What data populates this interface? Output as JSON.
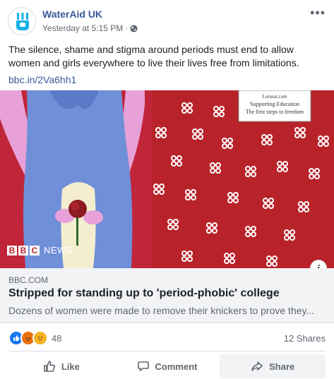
{
  "post": {
    "page_name": "WaterAid UK",
    "timestamp": "Yesterday at 5:15 PM",
    "separator": "·",
    "privacy_icon": "globe-icon",
    "more_label": "•••",
    "text": "The silence, shame and stigma around periods must end to allow women and girls everywhere to live their lives free from limitations.",
    "link_text": "bbc.in/2Va6hh1"
  },
  "link_preview": {
    "image_description_icon": "illustration",
    "sign_lines": [
      "Lorusat.com",
      "Supporting Education",
      "The first steps to freedom"
    ],
    "brand_letters": [
      "B",
      "B",
      "C"
    ],
    "brand_word": "NEWS",
    "info_label": "i",
    "domain": "BBC.COM",
    "headline": "Stripped for standing up to 'period-phobic' college",
    "description": "Dozens of women were made to remove their knickers to prove they..."
  },
  "engagement": {
    "reactions": [
      "like-icon",
      "angry-icon",
      "sad-icon"
    ],
    "reaction_count": "48",
    "shares": "12 Shares"
  },
  "actions": {
    "like": "Like",
    "comment": "Comment",
    "share": "Share"
  },
  "colors": {
    "accent": "#385898",
    "background_red": "#b8232a",
    "figure_blue": "#6f8fd8"
  }
}
